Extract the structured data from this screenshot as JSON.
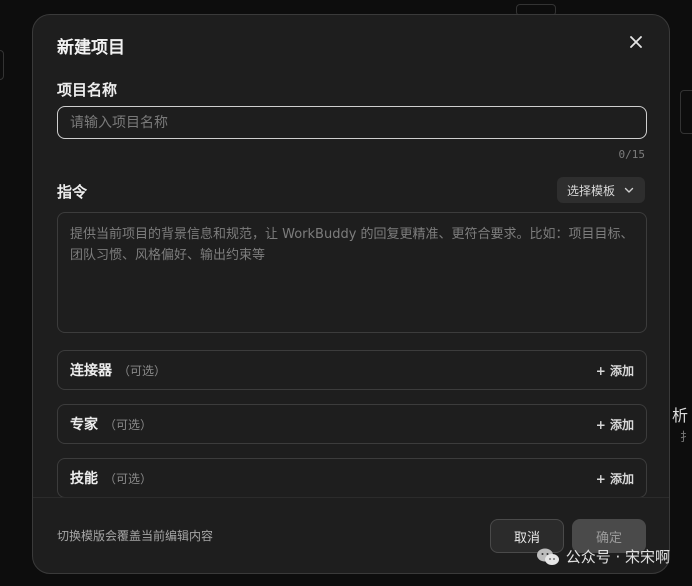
{
  "dialog": {
    "title": "新建项目",
    "close_icon": "close-icon"
  },
  "project_name": {
    "label": "项目名称",
    "placeholder": "请输入项目名称",
    "value": "",
    "counter": "0/15"
  },
  "instruction": {
    "label": "指令",
    "template_button": "选择模板",
    "placeholder": "提供当前项目的背景信息和规范，让 WorkBuddy 的回复更精准、更符合要求。比如：项目目标、团队习惯、风格偏好、输出约束等"
  },
  "options": [
    {
      "title": "连接器",
      "sub": "（可选）",
      "action": "+ 添加"
    },
    {
      "title": "专家",
      "sub": "（可选）",
      "action": "+ 添加"
    },
    {
      "title": "技能",
      "sub": "（可选）",
      "action": "+ 添加"
    }
  ],
  "footer": {
    "hint": "切换模版会覆盖当前编辑内容",
    "cancel": "取消",
    "confirm": "确定"
  },
  "background": {
    "fragment_1": "析",
    "fragment_2": "扌"
  },
  "watermark": {
    "text": "公众号 · 宋宋啊",
    "icon": "wechat-icon"
  },
  "colors": {
    "dialog_bg": "#1e1e1e",
    "page_bg": "#0d0d0d",
    "border": "#3c3c3c",
    "confirm_disabled": "#4a4a4a"
  }
}
